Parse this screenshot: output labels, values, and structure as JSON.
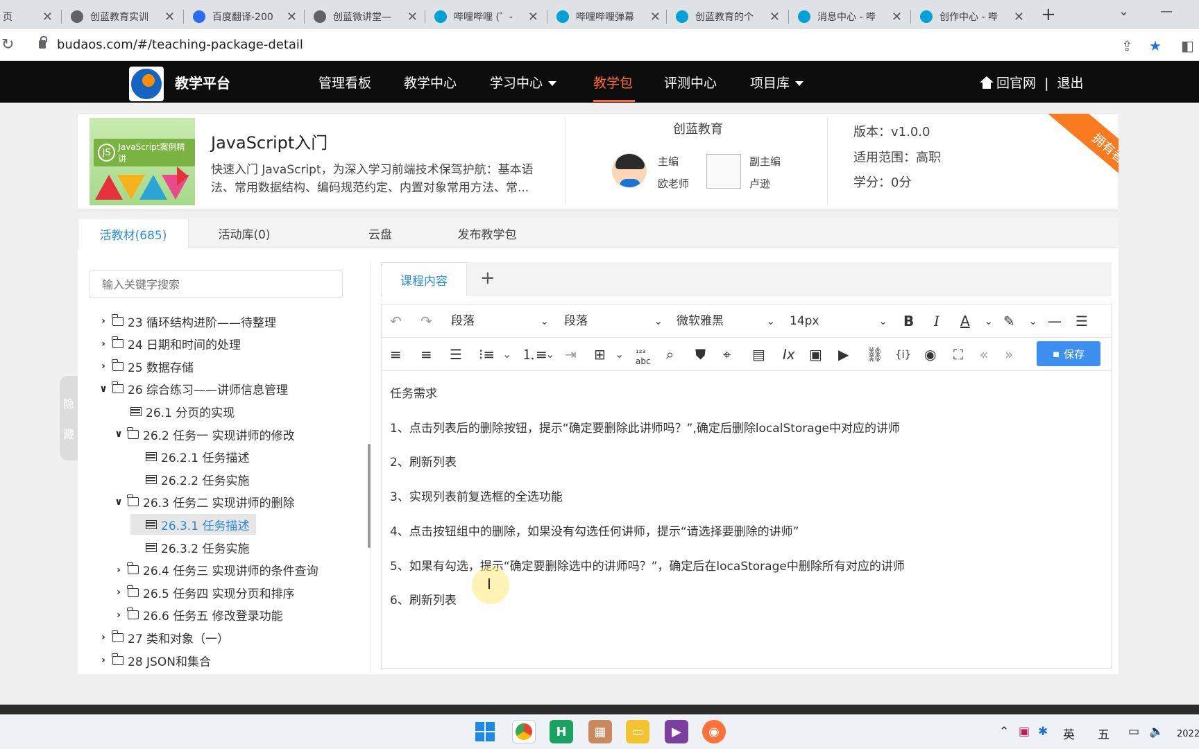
{
  "browser": {
    "tabs": [
      {
        "title": "创蓝教育实训",
        "icon": "globe-icon",
        "color": "#5f6368"
      },
      {
        "title": "百度翻译-200",
        "icon": "translate-icon",
        "color": "#2b6bf2"
      },
      {
        "title": "创蓝微讲堂—",
        "icon": "globe-icon",
        "color": "#5f6368"
      },
      {
        "title": "哔哩哔哩 (゜-",
        "icon": "bilibili-icon",
        "color": "#00a1d6"
      },
      {
        "title": "哔哩哔哩弹幕",
        "icon": "bilibili-icon",
        "color": "#00a1d6"
      },
      {
        "title": "创蓝教育的个",
        "icon": "bilibili-icon",
        "color": "#00a1d6"
      },
      {
        "title": "消息中心 - 哔",
        "icon": "bilibili-icon",
        "color": "#00a1d6"
      },
      {
        "title": "创作中心 - 哔",
        "icon": "bilibili-icon",
        "color": "#00a1d6"
      }
    ],
    "first_tab_fragment": "页",
    "url": "budaos.com/#/teaching-package-detail"
  },
  "header": {
    "brand": "教学平台",
    "nav": [
      {
        "label": "管理看板",
        "dropdown": false,
        "active": false
      },
      {
        "label": "教学中心",
        "dropdown": false,
        "active": false
      },
      {
        "label": "学习中心",
        "dropdown": true,
        "active": false
      },
      {
        "label": "教学包",
        "dropdown": false,
        "active": true
      },
      {
        "label": "评测中心",
        "dropdown": false,
        "active": false
      },
      {
        "label": "项目库",
        "dropdown": true,
        "active": false
      }
    ],
    "home_link": "回官网",
    "separator": "|",
    "logout": "退出",
    "accent": "#ff6a2a"
  },
  "package": {
    "cover_text": "JavaScript案例精讲",
    "title": "JavaScript入门",
    "description": "快速入门 JavaScript，为深入学习前端技术保驾护航：基本语法、常用数据结构、编码规范约定、内置对象常用方法、常...",
    "org": "创蓝教育",
    "chief_role": "主编",
    "chief_name": "欧老师",
    "deputy_role": "副主编",
    "deputy_name": "卢逊",
    "version": "版本：v1.0.0",
    "scope": "适用范围：高职",
    "credits": "学分：0分",
    "ribbon": "拥有者"
  },
  "page_tabs": [
    {
      "label": "活教材(685)",
      "active": true
    },
    {
      "label": "活动库(0)",
      "active": false
    },
    {
      "label": "云盘",
      "active": false
    },
    {
      "label": "发布教学包",
      "active": false
    }
  ],
  "sidebar": {
    "search_placeholder": "输入关键字搜索",
    "hide_label": [
      "隐",
      "藏"
    ],
    "tree": [
      {
        "label": "23 循环结构进阶——待整理",
        "level": 0,
        "type": "folder",
        "expanded": false
      },
      {
        "label": "24 日期和时间的处理",
        "level": 0,
        "type": "folder",
        "expanded": false
      },
      {
        "label": "25 数据存储",
        "level": 0,
        "type": "folder",
        "expanded": false
      },
      {
        "label": "26 综合练习——讲师信息管理",
        "level": 0,
        "type": "folder",
        "expanded": true
      },
      {
        "label": "26.1 分页的实现",
        "level": 1,
        "type": "doc"
      },
      {
        "label": "26.2 任务一 实现讲师的修改",
        "level": 1,
        "type": "folder",
        "expanded": true
      },
      {
        "label": "26.2.1 任务描述",
        "level": 2,
        "type": "doc"
      },
      {
        "label": "26.2.2 任务实施",
        "level": 2,
        "type": "doc"
      },
      {
        "label": "26.3 任务二 实现讲师的删除",
        "level": 1,
        "type": "folder",
        "expanded": true
      },
      {
        "label": "26.3.1 任务描述",
        "level": 2,
        "type": "doc",
        "selected": true
      },
      {
        "label": "26.3.2 任务实施",
        "level": 2,
        "type": "doc"
      },
      {
        "label": "26.4 任务三 实现讲师的条件查询",
        "level": 1,
        "type": "folder",
        "expanded": false
      },
      {
        "label": "26.5 任务四 实现分页和排序",
        "level": 1,
        "type": "folder",
        "expanded": false
      },
      {
        "label": "26.6 任务五 修改登录功能",
        "level": 1,
        "type": "folder",
        "expanded": false
      },
      {
        "label": "27 类和对象（一）",
        "level": 0,
        "type": "folder",
        "expanded": false
      },
      {
        "label": "28 JSON和集合",
        "level": 0,
        "type": "folder",
        "expanded": false
      }
    ]
  },
  "editor": {
    "tab": "课程内容",
    "add_tab": "+",
    "block_format_1": "段落",
    "block_format_2": "段落",
    "font_family": "微软雅黑",
    "font_size": "14px",
    "save_label": "保存",
    "content": [
      "任务需求",
      "1、点击列表后的删除按钮，提示“确定要删除此讲师吗？”,确定后删除localStorage中对应的讲师",
      "2、刷新列表",
      "3、实现列表前复选框的全选功能",
      "4、点击按钮组中的删除，如果没有勾选任何讲师，提示“请选择要删除的讲师”",
      "5、如果有勾选，提示“确定要删除选中的讲师吗？”，确定后在locaStorage中删除所有对应的讲师",
      "6、刷新列表"
    ]
  },
  "taskbar": {
    "tray_lang": "英",
    "tray_ime": "五",
    "clock_fragment": "2022"
  }
}
